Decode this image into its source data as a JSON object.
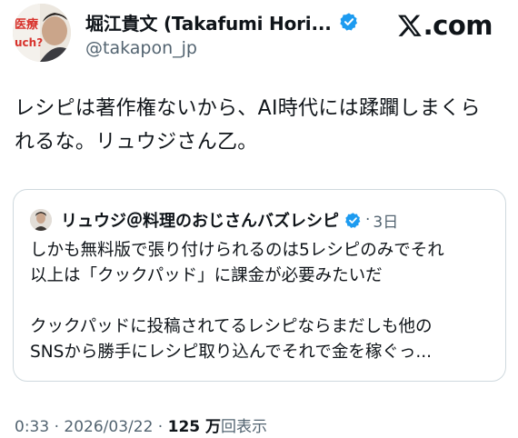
{
  "author": {
    "name": "堀江貴文 (Takafumi Hori...",
    "handle": "@takapon_jp",
    "avatar_text": "医療",
    "avatar_subtext": "uch?"
  },
  "brand": {
    "logo_text": ".com"
  },
  "tweet": {
    "lines": [
      "レシピは著作権ないから、AI時代には蹂躙しまくら",
      "れるな。リュウジさん乙。"
    ]
  },
  "quote": {
    "author_name": "リュウジ＠料理のおじさんバズレシピ",
    "separator": "·",
    "time": "3日",
    "lines": [
      "しかも無料版で張り付けられるのは5レシピのみでそれ",
      "以上は「クックパッド」に課金が必要みたいだ",
      "",
      "クックパッドに投稿されてるレシピならまだしも他の",
      "SNSから勝手にレシピ取り込んでそれで金を稼ぐっ..."
    ]
  },
  "footer": {
    "time": "0:33",
    "separator": "·",
    "date": "2026/03/22",
    "views_count": "125 万",
    "views_label": "回表示"
  },
  "colors": {
    "verified_blue": "#1d9bf0",
    "secondary_text": "#536471",
    "border": "#cfd9de"
  }
}
